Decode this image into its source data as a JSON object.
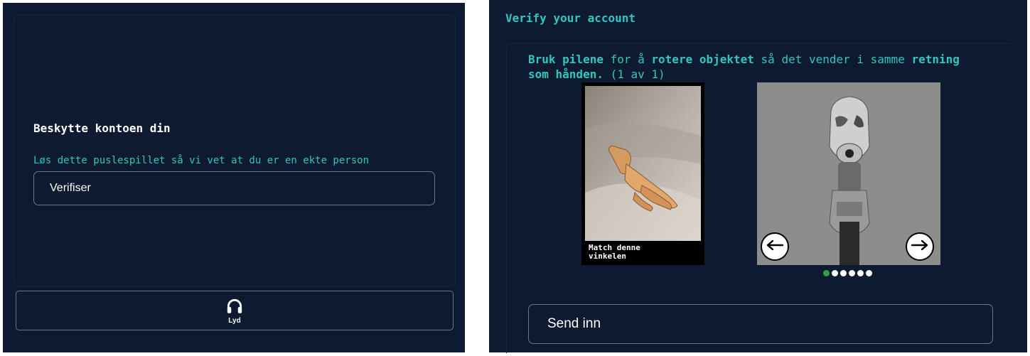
{
  "left": {
    "title": "Beskytte kontoen din",
    "subtitle": "Løs dette puslespillet så vi vet at du er en ekte person",
    "verify_label": "Verifiser",
    "audio_label": "Lyd",
    "audio_icon": "headphones-icon"
  },
  "right": {
    "title": "Verify your account",
    "instructions": {
      "p1": "Bruk pilene",
      "p2": " for å ",
      "p3": "rotere objektet",
      "p4": " så det vender i samme ",
      "p5": "retning som hånden.",
      "p6": " (1 av 1)"
    },
    "reference_caption": "Match denne vinkelen",
    "left_arrow_icon": "arrow-left-icon",
    "right_arrow_icon": "arrow-right-icon",
    "pagination": {
      "total": 6,
      "active_index": 0
    },
    "submit_label": "Send inn"
  },
  "colors": {
    "background": "#0d1a2f",
    "accent": "#2ec8c0",
    "active_dot": "#2e9e48"
  }
}
